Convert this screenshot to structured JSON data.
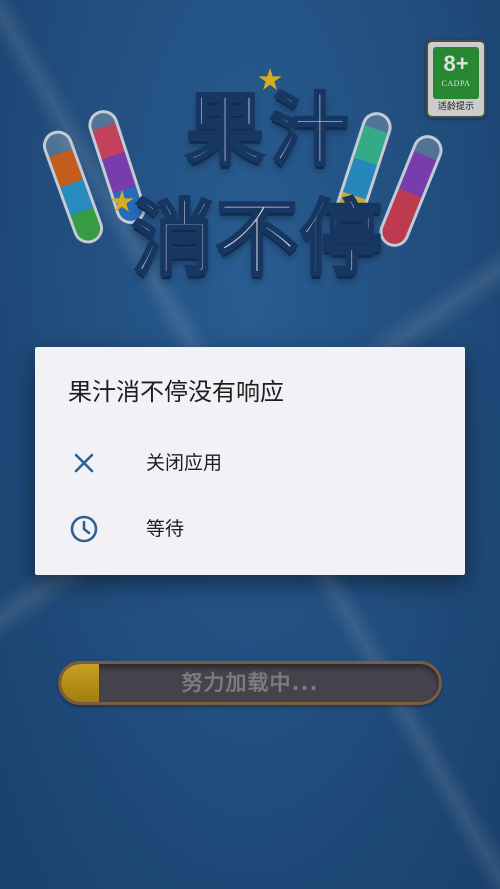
{
  "age_badge": {
    "rating": "8+",
    "org": "CADPA",
    "caption": "适龄提示",
    "color": "#2e9b3a"
  },
  "logo": {
    "line1": "果汁",
    "line2": "消不停"
  },
  "loading": {
    "text": "努力加载中...",
    "progress_percent": 10,
    "fill_color": "#d9ae22"
  },
  "dialog": {
    "title": "果汁消不停没有响应",
    "options": [
      {
        "label": "关闭应用",
        "icon": "close-icon"
      },
      {
        "label": "等待",
        "icon": "clock-icon"
      }
    ],
    "accent": "#2f5f93"
  }
}
